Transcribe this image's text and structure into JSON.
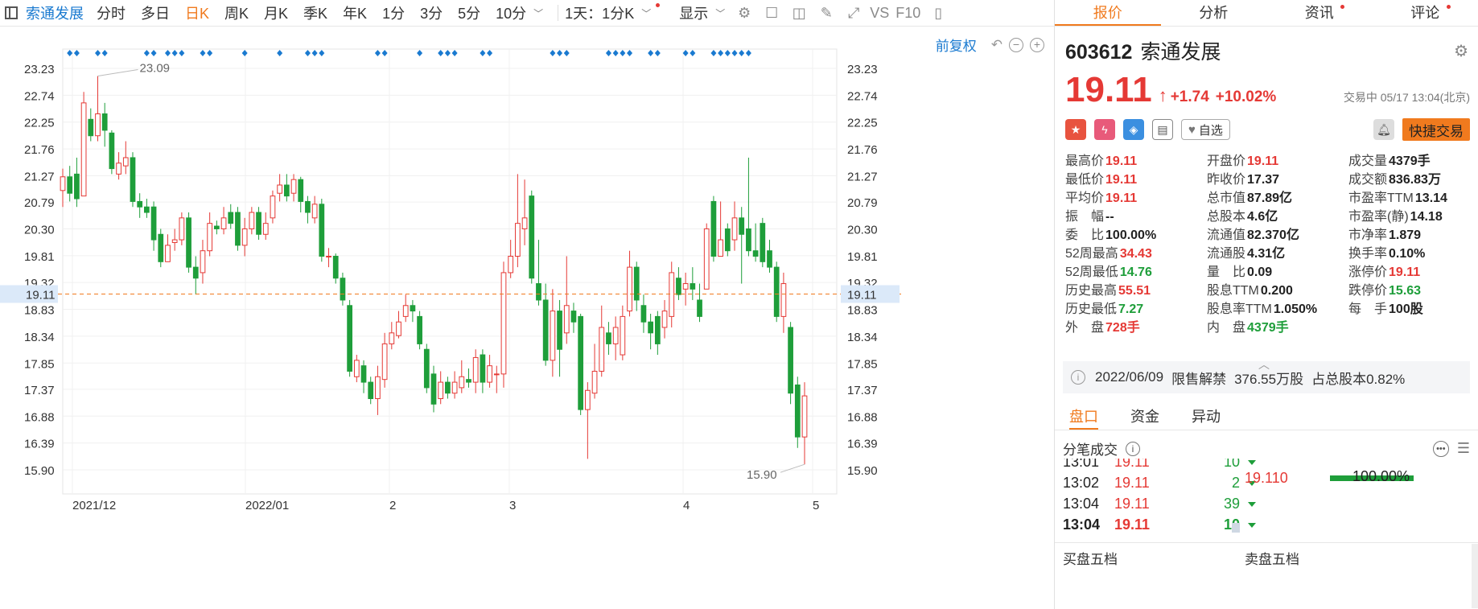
{
  "toolbar": {
    "stock_name": "索通发展",
    "periods": [
      "分时",
      "多日",
      "日K",
      "周K",
      "月K",
      "季K",
      "年K",
      "1分",
      "3分",
      "5分",
      "10分"
    ],
    "active_period": "日K",
    "interval_select": "1天：1分K",
    "display_label": "显示",
    "vs_label": "VS",
    "f10_label": "F10"
  },
  "chart": {
    "adjust_label": "前复权",
    "price_ticks": [
      "23.23",
      "22.74",
      "22.25",
      "21.76",
      "21.27",
      "20.79",
      "20.30",
      "19.81",
      "19.32",
      "18.83",
      "18.34",
      "17.85",
      "17.37",
      "16.88",
      "16.39",
      "15.90"
    ],
    "current_price_tag": "19.11",
    "max_label": "23.09",
    "min_label": "15.90",
    "x_labels": [
      "2021/12",
      "2022/01",
      "2",
      "3",
      "4",
      "5"
    ],
    "colors": {
      "up": "#e53935",
      "down": "#1e9e3a",
      "marker": "#1a7ad0",
      "current_line": "#f07a1e"
    }
  },
  "chart_data": {
    "type": "candlestick",
    "ylim": [
      15.9,
      23.23
    ],
    "current_price": 19.11,
    "annotated_high": 23.09,
    "annotated_low": 15.9,
    "x_ticks": [
      "2021/12",
      "2022/01",
      "2",
      "3",
      "4",
      "5"
    ],
    "candles": [
      [
        21.0,
        21.25,
        21.4,
        20.7
      ],
      [
        21.25,
        20.95,
        21.45,
        20.8
      ],
      [
        21.3,
        20.85,
        21.6,
        20.7
      ],
      [
        20.9,
        22.6,
        22.8,
        20.9
      ],
      [
        22.3,
        22.0,
        22.5,
        21.9
      ],
      [
        22.0,
        22.4,
        23.09,
        21.9
      ],
      [
        22.4,
        22.1,
        22.6,
        21.8
      ],
      [
        22.05,
        21.4,
        22.1,
        21.3
      ],
      [
        21.3,
        21.5,
        21.7,
        21.2
      ],
      [
        21.45,
        21.6,
        21.9,
        21.3
      ],
      [
        21.6,
        20.8,
        21.7,
        20.7
      ],
      [
        20.8,
        20.7,
        20.95,
        20.5
      ],
      [
        20.7,
        20.6,
        20.85,
        20.5
      ],
      [
        20.7,
        20.1,
        20.8,
        19.9
      ],
      [
        20.2,
        19.7,
        20.3,
        19.6
      ],
      [
        19.7,
        20.0,
        20.2,
        19.7
      ],
      [
        20.05,
        20.1,
        20.3,
        19.9
      ],
      [
        20.1,
        20.5,
        20.6,
        20.0
      ],
      [
        20.5,
        19.6,
        20.6,
        19.5
      ],
      [
        19.6,
        19.4,
        19.8,
        19.1
      ],
      [
        19.5,
        19.9,
        20.1,
        19.3
      ],
      [
        19.9,
        20.4,
        20.6,
        19.8
      ],
      [
        20.35,
        20.3,
        20.45,
        20.2
      ],
      [
        20.3,
        20.5,
        20.7,
        20.2
      ],
      [
        20.6,
        20.4,
        20.75,
        20.3
      ],
      [
        20.6,
        20.0,
        20.7,
        19.9
      ],
      [
        20.0,
        20.3,
        20.5,
        19.8
      ],
      [
        20.3,
        20.6,
        20.7,
        20.2
      ],
      [
        20.6,
        20.2,
        20.7,
        20.1
      ],
      [
        20.2,
        20.4,
        20.6,
        20.1
      ],
      [
        20.5,
        20.9,
        21.0,
        20.4
      ],
      [
        20.95,
        21.1,
        21.3,
        20.8
      ],
      [
        21.1,
        20.9,
        21.3,
        20.8
      ],
      [
        20.95,
        21.2,
        21.3,
        20.8
      ],
      [
        21.2,
        20.8,
        21.25,
        20.6
      ],
      [
        20.8,
        20.6,
        20.9,
        20.4
      ],
      [
        20.5,
        20.75,
        20.9,
        20.4
      ],
      [
        20.75,
        19.8,
        20.85,
        19.7
      ],
      [
        19.8,
        19.8,
        19.95,
        19.6
      ],
      [
        19.8,
        19.4,
        19.85,
        19.3
      ],
      [
        19.4,
        19.0,
        19.5,
        18.9
      ],
      [
        18.9,
        17.7,
        19.0,
        17.6
      ],
      [
        17.6,
        17.9,
        18.0,
        17.5
      ],
      [
        17.8,
        17.5,
        17.9,
        17.3
      ],
      [
        17.5,
        17.2,
        17.6,
        17.1
      ],
      [
        17.2,
        17.6,
        17.8,
        16.9
      ],
      [
        17.55,
        18.2,
        18.4,
        17.4
      ],
      [
        18.2,
        18.4,
        18.6,
        18.1
      ],
      [
        18.35,
        18.6,
        18.8,
        18.3
      ],
      [
        18.7,
        18.9,
        19.1,
        18.6
      ],
      [
        18.9,
        18.8,
        19.0,
        18.6
      ],
      [
        18.7,
        18.2,
        18.8,
        18.1
      ],
      [
        18.1,
        17.4,
        18.2,
        17.3
      ],
      [
        17.65,
        17.1,
        17.8,
        16.95
      ],
      [
        17.2,
        17.5,
        17.7,
        17.1
      ],
      [
        17.5,
        17.3,
        17.6,
        17.2
      ],
      [
        17.3,
        17.5,
        17.7,
        17.2
      ],
      [
        17.4,
        17.6,
        17.9,
        17.3
      ],
      [
        17.55,
        17.5,
        17.75,
        17.4
      ],
      [
        17.5,
        17.95,
        18.1,
        17.3
      ],
      [
        18.0,
        17.5,
        18.1,
        17.3
      ],
      [
        17.5,
        17.8,
        18.0,
        17.4
      ],
      [
        17.65,
        17.65,
        17.8,
        17.3
      ],
      [
        17.65,
        19.5,
        19.7,
        17.4
      ],
      [
        19.5,
        19.8,
        20.1,
        19.4
      ],
      [
        19.8,
        20.4,
        21.3,
        19.6
      ],
      [
        20.3,
        20.5,
        21.2,
        20.0
      ],
      [
        20.9,
        19.4,
        21.0,
        19.3
      ],
      [
        19.3,
        19.0,
        20.1,
        18.9
      ],
      [
        19.0,
        17.9,
        19.3,
        17.8
      ],
      [
        17.9,
        18.8,
        19.2,
        17.6
      ],
      [
        18.8,
        18.1,
        19.0,
        17.6
      ],
      [
        18.4,
        18.9,
        19.8,
        18.2
      ],
      [
        18.8,
        18.6,
        18.95,
        18.4
      ],
      [
        18.7,
        17.0,
        18.75,
        16.9
      ],
      [
        17.0,
        17.35,
        17.5,
        16.1
      ],
      [
        17.3,
        17.7,
        18.2,
        17.2
      ],
      [
        17.7,
        18.5,
        18.9,
        17.6
      ],
      [
        18.4,
        18.2,
        18.6,
        18.0
      ],
      [
        18.2,
        18.5,
        18.7,
        17.9
      ],
      [
        18.0,
        18.7,
        18.9,
        17.9
      ],
      [
        18.8,
        19.6,
        19.9,
        18.7
      ],
      [
        19.6,
        19.0,
        19.7,
        18.8
      ],
      [
        18.9,
        18.6,
        19.1,
        18.4
      ],
      [
        18.6,
        18.4,
        18.75,
        18.1
      ],
      [
        18.7,
        18.2,
        18.8,
        18.0
      ],
      [
        18.5,
        18.8,
        19.0,
        18.3
      ],
      [
        18.7,
        19.5,
        19.7,
        18.5
      ],
      [
        19.4,
        19.1,
        19.6,
        19.0
      ],
      [
        19.2,
        19.3,
        19.5,
        18.9
      ],
      [
        19.3,
        19.2,
        19.6,
        19.0
      ],
      [
        19.0,
        18.7,
        19.3,
        18.6
      ],
      [
        19.2,
        20.3,
        20.4,
        19.2
      ],
      [
        20.8,
        19.8,
        20.9,
        19.7
      ],
      [
        19.8,
        20.1,
        20.8,
        19.8
      ],
      [
        20.3,
        19.9,
        20.4,
        19.8
      ],
      [
        20.1,
        20.5,
        20.8,
        19.9
      ],
      [
        20.5,
        20.2,
        20.7,
        19.3
      ],
      [
        20.3,
        19.9,
        21.6,
        19.8
      ],
      [
        19.9,
        19.8,
        20.4,
        19.7
      ],
      [
        20.4,
        19.7,
        20.5,
        19.6
      ],
      [
        19.9,
        19.6,
        20.1,
        19.5
      ],
      [
        19.6,
        18.7,
        19.7,
        18.6
      ],
      [
        18.7,
        19.3,
        19.5,
        18.4
      ],
      [
        18.5,
        17.3,
        18.6,
        17.1
      ],
      [
        17.45,
        16.5,
        17.6,
        16.3
      ],
      [
        16.5,
        17.25,
        17.5,
        16.0
      ]
    ]
  },
  "panel": {
    "tabs": [
      {
        "label": "报价"
      },
      {
        "label": "分析"
      },
      {
        "label": "资讯"
      },
      {
        "label": "评论"
      }
    ],
    "code": "603612",
    "name": "索通发展",
    "price": "19.11",
    "change": "+1.74",
    "change_pct": "+10.02%",
    "trade_status": "交易中 05/17 13:04(北京)",
    "watch_label": "自选",
    "fast_trade_label": "快捷交易",
    "quotes": [
      {
        "label": "最高价",
        "value": "19.11",
        "color": "red"
      },
      {
        "label": "开盘价",
        "value": "19.11",
        "color": "red"
      },
      {
        "label": "成交量",
        "value": "4379手",
        "color": "blk"
      },
      {
        "label": "最低价",
        "value": "19.11",
        "color": "red"
      },
      {
        "label": "昨收价",
        "value": "17.37",
        "color": "blk"
      },
      {
        "label": "成交额",
        "value": "836.83万",
        "color": "blk"
      },
      {
        "label": "平均价",
        "value": "19.11",
        "color": "red"
      },
      {
        "label": "总市值",
        "value": "87.89亿",
        "color": "blk"
      },
      {
        "label": "市盈率TTM",
        "value": "13.14",
        "color": "blk"
      },
      {
        "label": "振　幅",
        "value": "--",
        "color": "blk"
      },
      {
        "label": "总股本",
        "value": "4.6亿",
        "color": "blk"
      },
      {
        "label": "市盈率(静)",
        "value": "14.18",
        "color": "blk"
      },
      {
        "label": "委　比",
        "value": "100.00%",
        "color": "blk"
      },
      {
        "label": "流通值",
        "value": "82.370亿",
        "color": "blk"
      },
      {
        "label": "市净率",
        "value": "1.879",
        "color": "blk"
      },
      {
        "label": "52周最高",
        "value": "34.43",
        "color": "red"
      },
      {
        "label": "流通股",
        "value": "4.31亿",
        "color": "blk"
      },
      {
        "label": "换手率",
        "value": "0.10%",
        "color": "blk"
      },
      {
        "label": "52周最低",
        "value": "14.76",
        "color": "green"
      },
      {
        "label": "量　比",
        "value": "0.09",
        "color": "blk"
      },
      {
        "label": "涨停价",
        "value": "19.11",
        "color": "red"
      },
      {
        "label": "历史最高",
        "value": "55.51",
        "color": "red"
      },
      {
        "label": "股息TTM",
        "value": "0.200",
        "color": "blk"
      },
      {
        "label": "跌停价",
        "value": "15.63",
        "color": "green"
      },
      {
        "label": "历史最低",
        "value": "7.27",
        "color": "green"
      },
      {
        "label": "股息率TTM",
        "value": "1.050%",
        "color": "blk"
      },
      {
        "label": "每　手",
        "value": "100股",
        "color": "blk"
      },
      {
        "label": "外　盘",
        "value": "728手",
        "color": "red"
      },
      {
        "label": "内　盘",
        "value": "4379手",
        "color": "green"
      }
    ],
    "notice": {
      "date": "2022/06/09",
      "text1": "限售解禁",
      "text2": "376.55万股",
      "text3": "占总股本0.82%"
    },
    "subtabs": [
      {
        "label": "盘口"
      },
      {
        "label": "资金"
      },
      {
        "label": "异动"
      }
    ],
    "fenbi_title": "分笔成交",
    "trades": [
      {
        "time": "13:01",
        "price": "19.11",
        "vol": "10"
      },
      {
        "time": "13:02",
        "price": "19.11",
        "vol": "2"
      },
      {
        "time": "13:04",
        "price": "19.11",
        "vol": "39"
      },
      {
        "time": "13:04",
        "price": "19.11",
        "vol": "10"
      }
    ],
    "ratio_price": "19.110",
    "ratio_pct": "100.00%",
    "buy5": "买盘五档",
    "sell5": "卖盘五档"
  }
}
